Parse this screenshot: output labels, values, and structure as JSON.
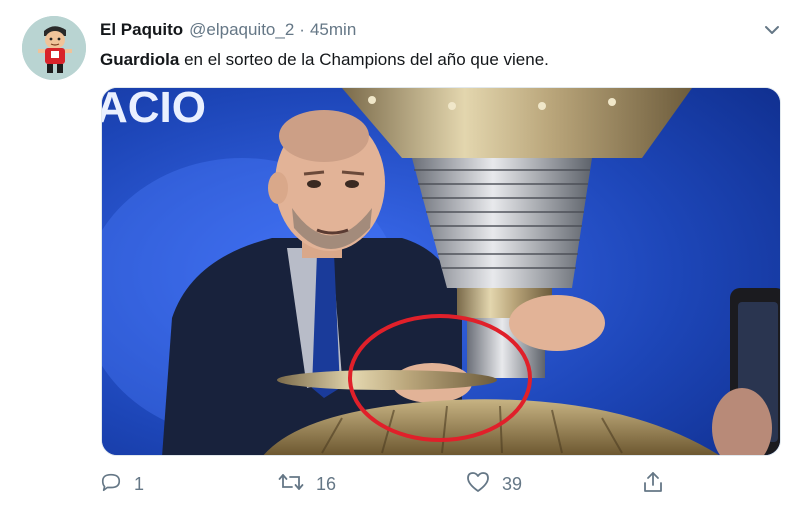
{
  "tweet": {
    "author_name": "El Paquito",
    "handle": "@elpaquito_2",
    "separator": "·",
    "time": "45min",
    "text_bold": "Guardiola",
    "text_rest": " en el sorteo de la Champions del año que viene.",
    "media": {
      "banner_text": "ACIO",
      "icon": "photo"
    },
    "actions": {
      "reply_count": "1",
      "retweet_count": "16",
      "like_count": "39",
      "share_icon": "share-icon"
    }
  },
  "colors": {
    "text": "#14171a",
    "secondary": "#657786",
    "annotation_circle": "#e0202a"
  }
}
